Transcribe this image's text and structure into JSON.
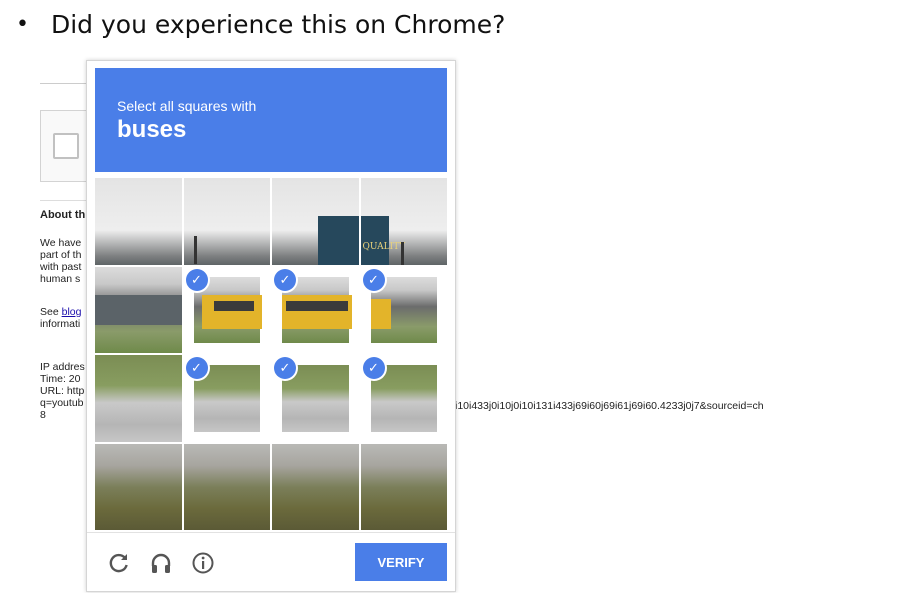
{
  "slide": {
    "bullet": "•",
    "question": "Did you experience this on Chrome?"
  },
  "background_page": {
    "about_heading": "About th",
    "paragraph_lines": [
      "We have",
      "part of th",
      "with past",
      "human s"
    ],
    "see_prefix": "See ",
    "blog_link": "blog",
    "information": "informati",
    "ip_lines": [
      "IP addres",
      "Time: 20",
      "URL: http",
      "q=youtub",
      "8"
    ],
    "url_tail": "i10i433j0i10j0i10i131i433j69i60j69i61j69i60.4233j0j7&sourceid=ch"
  },
  "captcha": {
    "instruction": "Select all squares with",
    "object": "buses",
    "selected_tiles": [
      5,
      6,
      7,
      9,
      10,
      11
    ],
    "sign_text": "QUALITY",
    "footer": {
      "reload_icon": "reload-icon",
      "audio_icon": "headphones-icon",
      "info_icon": "info-icon",
      "verify_label": "VERIFY"
    },
    "colors": {
      "accent": "#4a7ee8"
    }
  }
}
